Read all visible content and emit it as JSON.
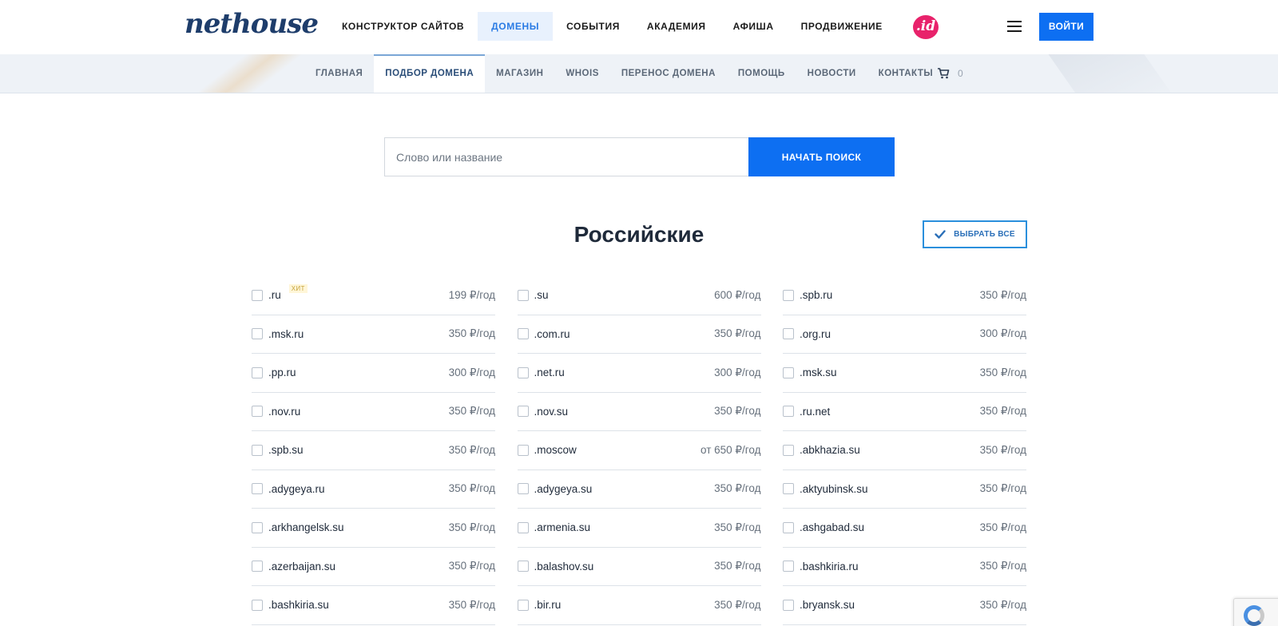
{
  "brand": {
    "logo_text": "nethouse"
  },
  "top_nav": {
    "items": [
      {
        "label": "КОНСТРУКТОР САЙТОВ"
      },
      {
        "label": "ДОМЕНЫ",
        "active": true
      },
      {
        "label": "СОБЫТИЯ"
      },
      {
        "label": "АКАДЕМИЯ"
      },
      {
        "label": "АФИША"
      },
      {
        "label": "ПРОДВИЖЕНИЕ"
      }
    ],
    "id_badge": ".id",
    "login_label": "ВОЙТИ"
  },
  "sub_nav": {
    "items": [
      {
        "label": "ГЛАВНАЯ"
      },
      {
        "label": "ПОДБОР ДОМЕНА",
        "active": true
      },
      {
        "label": "МАГАЗИН"
      },
      {
        "label": "WHOIS"
      },
      {
        "label": "ПЕРЕНОС ДОМЕНА"
      },
      {
        "label": "ПОМОЩЬ"
      },
      {
        "label": "НОВОСТИ"
      },
      {
        "label": "КОНТАКТЫ"
      }
    ],
    "cart_count": "0"
  },
  "search": {
    "placeholder": "Слово или название",
    "value": "",
    "button_label": "НАЧАТЬ ПОИСК"
  },
  "section": {
    "title": "Российские",
    "select_all_label": "ВЫБРАТЬ ВСЕ"
  },
  "domains": [
    {
      "zone": ".ru",
      "price": "199 ₽/год",
      "badge": "ХИТ"
    },
    {
      "zone": ".su",
      "price": "600 ₽/год"
    },
    {
      "zone": ".spb.ru",
      "price": "350 ₽/год"
    },
    {
      "zone": ".msk.ru",
      "price": "350 ₽/год"
    },
    {
      "zone": ".com.ru",
      "price": "350 ₽/год"
    },
    {
      "zone": ".org.ru",
      "price": "300 ₽/год"
    },
    {
      "zone": ".pp.ru",
      "price": "300 ₽/год"
    },
    {
      "zone": ".net.ru",
      "price": "300 ₽/год"
    },
    {
      "zone": ".msk.su",
      "price": "350 ₽/год"
    },
    {
      "zone": ".nov.ru",
      "price": "350 ₽/год"
    },
    {
      "zone": ".nov.su",
      "price": "350 ₽/год"
    },
    {
      "zone": ".ru.net",
      "price": "350 ₽/год"
    },
    {
      "zone": ".spb.su",
      "price": "350 ₽/год"
    },
    {
      "zone": ".moscow",
      "price": "от 650 ₽/год"
    },
    {
      "zone": ".abkhazia.su",
      "price": "350 ₽/год"
    },
    {
      "zone": ".adygeya.ru",
      "price": "350 ₽/год"
    },
    {
      "zone": ".adygeya.su",
      "price": "350 ₽/год"
    },
    {
      "zone": ".aktyubinsk.su",
      "price": "350 ₽/год"
    },
    {
      "zone": ".arkhangelsk.su",
      "price": "350 ₽/год"
    },
    {
      "zone": ".armenia.su",
      "price": "350 ₽/год"
    },
    {
      "zone": ".ashgabad.su",
      "price": "350 ₽/год"
    },
    {
      "zone": ".azerbaijan.su",
      "price": "350 ₽/год"
    },
    {
      "zone": ".balashov.su",
      "price": "350 ₽/год"
    },
    {
      "zone": ".bashkiria.ru",
      "price": "350 ₽/год"
    },
    {
      "zone": ".bashkiria.su",
      "price": "350 ₽/год"
    },
    {
      "zone": ".bir.ru",
      "price": "350 ₽/год"
    },
    {
      "zone": ".bryansk.su",
      "price": "350 ₽/год"
    }
  ],
  "colors": {
    "accent": "#0d6ff2",
    "id_badge": "#e8226b"
  }
}
